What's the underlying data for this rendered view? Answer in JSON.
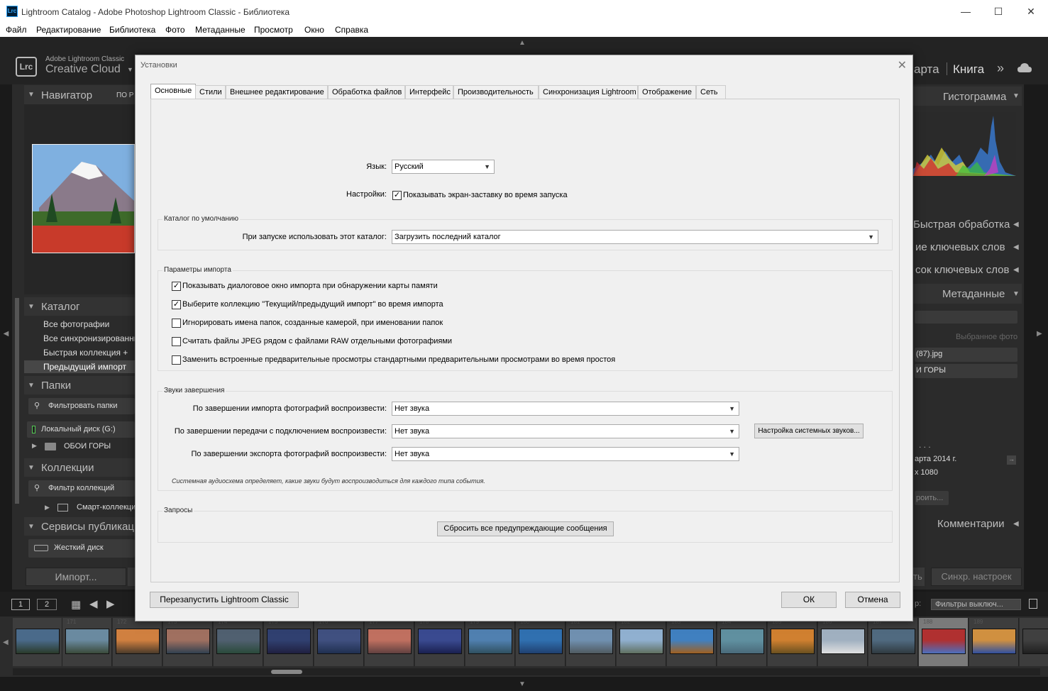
{
  "window": {
    "title": "Lightroom Catalog - Adobe Photoshop Lightroom Classic - Библиотека",
    "app_icon": "Lrc",
    "minimize": "—",
    "maximize": "☐",
    "close": "✕"
  },
  "menu": [
    "Файл",
    "Редактирование",
    "Библиотека",
    "Фото",
    "Метаданные",
    "Просмотр",
    "Окно",
    "Справка"
  ],
  "identity": {
    "logo": "Lrc",
    "brand_small": "Adobe Lightroom Classic",
    "brand_large": "Creative Cloud"
  },
  "modules": {
    "map": "арта",
    "book": "Книга",
    "more": "»"
  },
  "left": {
    "navigator": "Навигатор",
    "nav_fit": "ПО Р",
    "catalog": "Каталог",
    "catalog_items": [
      "Все фотографии",
      "Все синхронизированные",
      "Быстрая коллекция  +",
      "Предыдущий импорт"
    ],
    "folders": "Папки",
    "filter_folders": "Фильтровать папки",
    "disk": "Локальный диск (G:)",
    "folder": "ОБОИ ГОРЫ",
    "collections": "Коллекции",
    "filter_collections": "Фильтр коллекций",
    "smart": "Смарт-коллекци",
    "publish": "Сервисы публикаци",
    "harddisk": "Жесткий диск",
    "import": "Импорт..."
  },
  "right": {
    "histogram": "Гистограмма",
    "quick": "Быстрая обработка",
    "keywording": "ие ключевых слов",
    "keyword_list": "сок ключевых слов",
    "metadata": "Метаданные",
    "selected": "Выбранное фото",
    "file": "(87).jpg",
    "folder": "И ГОРЫ",
    "date": "арта 2014 г.",
    "size": "х 1080",
    "dots": ". . .",
    "build": "роить...",
    "comments": "Комментарии",
    "sync": "Синхр. настроек",
    "sync_prev": "ть",
    "filter": "Фильтры выключ...",
    "filter_lbl": "р:"
  },
  "dialog": {
    "title": "Установки",
    "close": "✕",
    "tabs": [
      "Основные",
      "Стили",
      "Внешнее редактирование",
      "Обработка файлов",
      "Интерфейс",
      "Производительность",
      "Синхронизация Lightroom",
      "Отображение",
      "Сеть"
    ],
    "language_label": "Язык:",
    "language": "Русский",
    "settings_label": "Настройки:",
    "splash": "Показывать экран-заставку во время запуска",
    "catalog_group": "Каталог по умолчанию",
    "catalog_label": "При запуске использовать этот каталог:",
    "catalog_value": "Загрузить последний каталог",
    "import_group": "Параметры импорта",
    "import_options": [
      {
        "label": "Показывать диалоговое окно импорта при обнаружении карты памяти",
        "checked": true
      },
      {
        "label": "Выберите коллекцию \"Текущий/предыдущий импорт\" во время импорта",
        "checked": true
      },
      {
        "label": "Игнорировать имена папок, созданные камерой, при именовании папок",
        "checked": false
      },
      {
        "label": "Считать файлы JPEG рядом с файлами RAW отдельными фотографиями",
        "checked": false
      },
      {
        "label": "Заменить встроенные предварительные просмотры стандартными предварительными просмотрами во время простоя",
        "checked": false
      }
    ],
    "sounds_group": "Звуки завершения",
    "sounds": [
      {
        "label": "По завершении импорта фотографий воспроизвести:",
        "value": "Нет звука"
      },
      {
        "label": "По завершении передачи с подключением воспроизвести:",
        "value": "Нет звука"
      },
      {
        "label": "По завершении экспорта фотографий воспроизвести:",
        "value": "Нет звука"
      }
    ],
    "system_sounds_button": "Настройка системных звуков...",
    "sounds_note": "Системная аудиосхема определяет, какие звуки будут воспроизводиться для каждого типа события.",
    "prompts_group": "Запросы",
    "reset_button": "Сбросить все предупреждающие сообщения",
    "restart_button": "Перезапустить Lightroom Classic",
    "ok": "ОК",
    "cancel": "Отмена"
  },
  "filmstrip": {
    "view1": "1",
    "view2": "2",
    "numbers": [
      "171",
      "172",
      "173",
      "174",
      "175",
      "176",
      "177",
      "178",
      "179",
      "180",
      "181",
      "182",
      "183",
      "184",
      "185",
      "186",
      "187",
      "188",
      "189"
    ]
  },
  "colors": {
    "accent": "#31a8ff",
    "panel": "#2b2b2b",
    "dialog": "#f0f0f0"
  }
}
